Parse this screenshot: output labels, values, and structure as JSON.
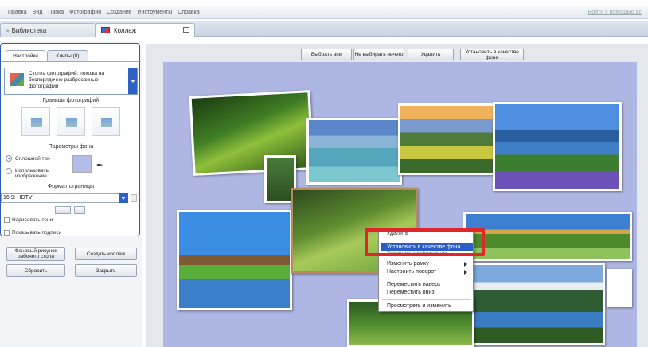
{
  "menu": {
    "items": [
      "Правка",
      "Вид",
      "Папка",
      "Фотография",
      "Создание",
      "Инструменты",
      "Справка"
    ],
    "help_link": "Войти с помощью ac"
  },
  "tabs": {
    "library": "Библиотека",
    "collage": "Коллаж"
  },
  "left_panel": {
    "tab_settings": "Настройки",
    "tab_clips": "Клипы (0)",
    "preset_text": "Стопка фотографий: похожа на беспорядочно разбросанные фотографии",
    "photo_borders_title": "Границы фотографий",
    "bg_params_title": "Параметры фона",
    "solid_color": "Сплошной тон",
    "use_image": "Использовать изображение",
    "bg_color": "#b4bde8",
    "page_format_title": "Формат страницы",
    "page_format_value": "16:9: HDTV",
    "draw_shadows": "Нарисовать тени",
    "show_captions": "Показывать подписи",
    "desktop_bg_button": "Фоновый рисунок рабочего стола",
    "create_collage_button": "Создать коллаж",
    "reset_button": "Сбросить",
    "close_button": "Закрыть"
  },
  "toolbar": {
    "select_all": "Выбрать все",
    "select_none": "Не выбирать ничего",
    "delete": "Удалить",
    "set_background": "Установить в качестве фона"
  },
  "context_menu": {
    "delete": "Удалить",
    "set_background": "Установить в качестве фона",
    "hidden_item": "Заменить изображение",
    "change_frame": "Изменить рамку",
    "rotation": "Настроить поворот",
    "move_top": "Переместить наверх",
    "move_bottom": "Переместить вниз",
    "view_edit": "Просмотреть и изменить"
  },
  "colors": {
    "accent": "#2c5cc5",
    "highlight_box": "#e0262b",
    "canvas_bg": "#aeb6e3"
  }
}
